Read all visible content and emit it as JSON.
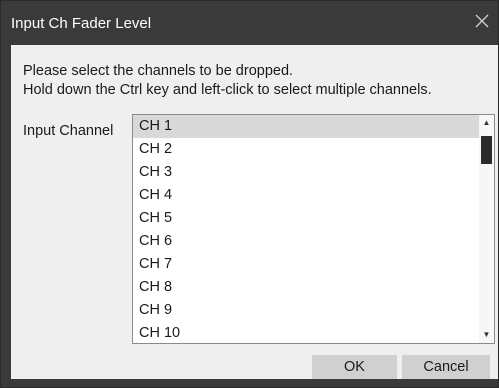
{
  "dialog": {
    "title": "Input Ch Fader Level",
    "message_line1": "Please select the channels to be dropped.",
    "message_line2": "Hold down the Ctrl key and left-click to select multiple channels.",
    "input_channel_label": "Input Channel",
    "channels": [
      "CH 1",
      "CH 2",
      "CH 3",
      "CH 4",
      "CH 5",
      "CH 6",
      "CH 7",
      "CH 8",
      "CH 9",
      "CH 10"
    ],
    "selected_channel": "CH 1",
    "ok_label": "OK",
    "cancel_label": "Cancel",
    "icons": {
      "close": "close-icon",
      "scroll_up": "scroll-up-arrow-icon",
      "scroll_down": "scroll-down-arrow-icon"
    },
    "colors": {
      "chrome": "#3a3a3a",
      "panel": "#efefef",
      "selection": "#d9d9d9",
      "button": "#d0d0d0"
    }
  }
}
